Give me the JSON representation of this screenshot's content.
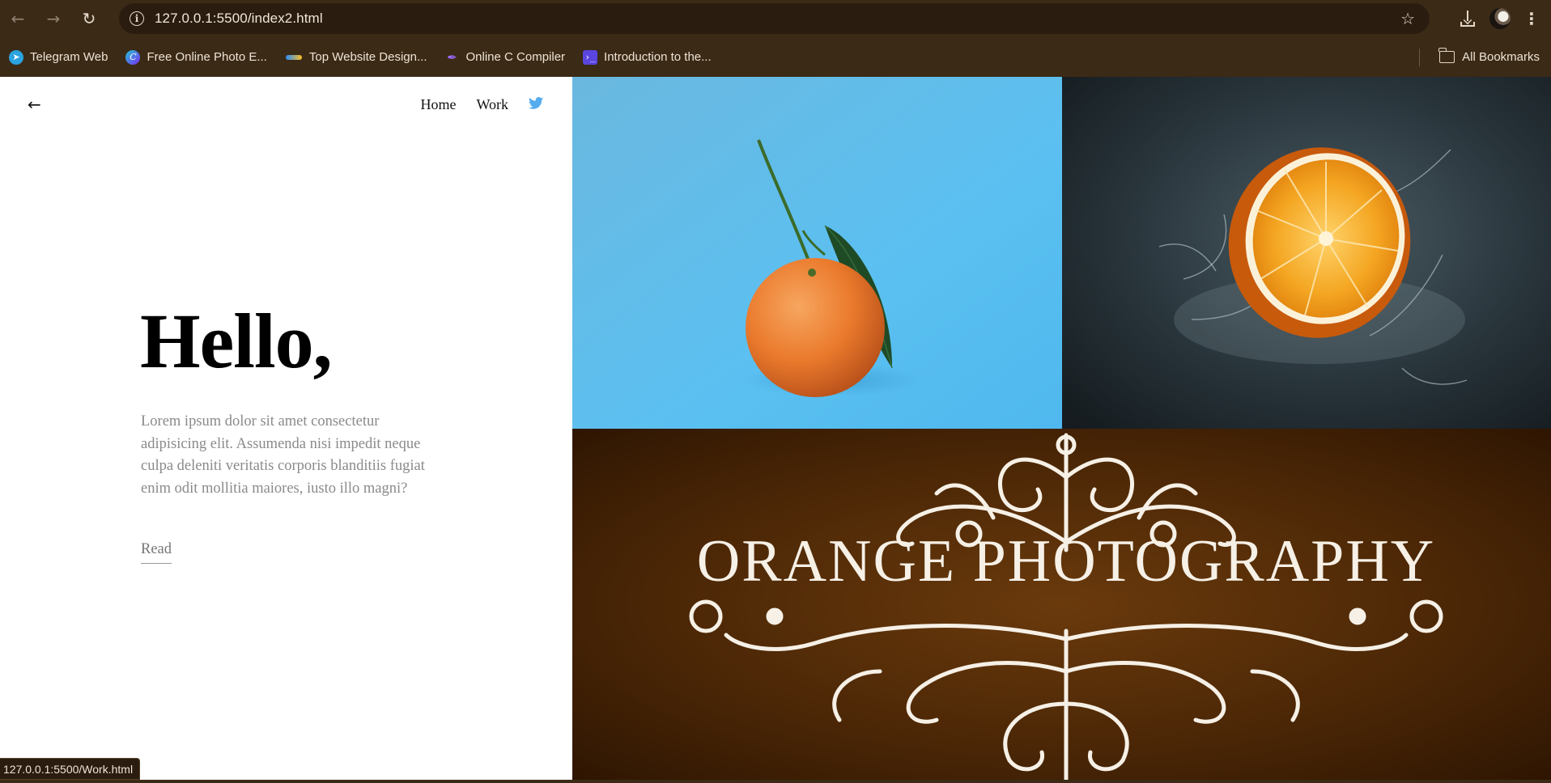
{
  "browser": {
    "url": "127.0.0.1:5500/index2.html",
    "bookmarks": [
      {
        "label": "Telegram Web",
        "icon": "telegram-icon"
      },
      {
        "label": "Free Online Photo E...",
        "icon": "canva-icon"
      },
      {
        "label": "Top Website Design...",
        "icon": "wave-icon"
      },
      {
        "label": "Online C Compiler",
        "icon": "pen-icon"
      },
      {
        "label": "Introduction to the...",
        "icon": "terminal-icon"
      }
    ],
    "all_bookmarks_label": "All Bookmarks",
    "status_url": "127.0.0.1:5500/Work.html"
  },
  "site": {
    "nav": {
      "home": "Home",
      "work": "Work"
    },
    "hero": {
      "title": "Hello,",
      "body": "Lorem ipsum dolor sit amet consectetur adipisicing elit. Assumenda nisi impedit neque culpa deleniti veritatis corporis blanditiis fugiat enim odit mollitia maiores, iusto illo magni?",
      "read_label": "Read"
    },
    "gallery": {
      "banner_text": "ORANGE PHOTOGRAPHY"
    }
  },
  "colors": {
    "chrome": "#3b2a16",
    "twitter": "#55acee",
    "banner_bg": "#4a2606"
  }
}
